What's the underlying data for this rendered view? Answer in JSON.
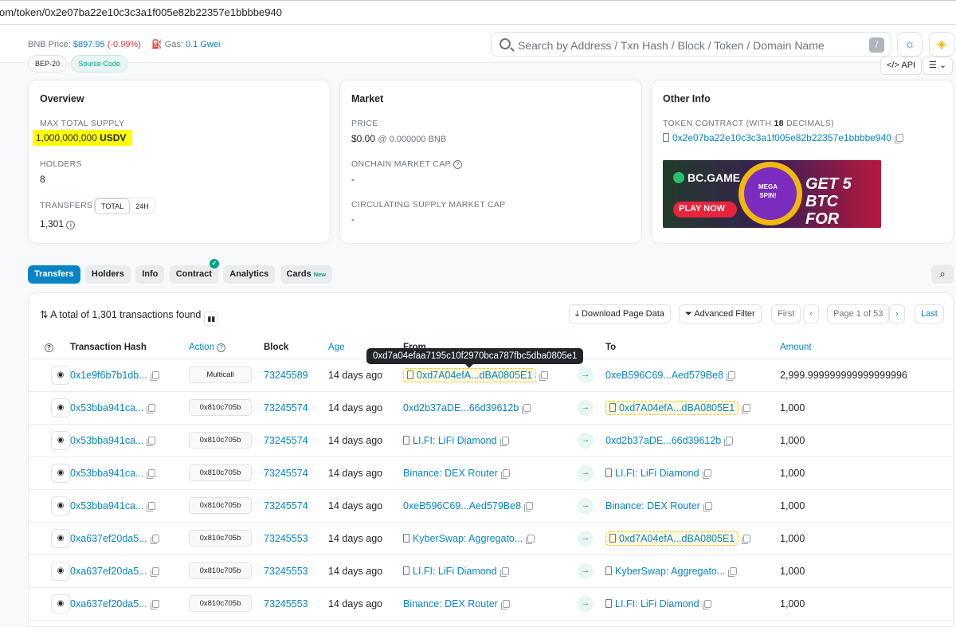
{
  "browser": {
    "url": "om/token/0x2e07ba22e10c3c3a1f005e82b22357e1bbbbe940"
  },
  "header": {
    "bnb_label": "BNB Price:",
    "bnb_price": "$897.95",
    "bnb_change": "(-0.99%)",
    "gas_label": "Gas:",
    "gas_value": "0.1 Gwei",
    "search_placeholder": "Search by Address / Txn Hash / Block / Token / Domain Name",
    "search_shortcut": "/"
  },
  "tags": [
    "BEP-20",
    "Source Code"
  ],
  "api_label": "API",
  "overview": {
    "title": "Overview",
    "max_supply_label": "MAX TOTAL SUPPLY",
    "max_supply_value": "1,000,000,000",
    "max_supply_unit": "USDV",
    "holders_label": "HOLDERS",
    "holders_value": "8",
    "transfers_label": "TRANSFERS",
    "toggle_total": "TOTAL",
    "toggle_24h": "24H",
    "transfers_value": "1,301"
  },
  "market": {
    "title": "Market",
    "price_label": "PRICE",
    "price_value": "$0.00",
    "price_bnb": "@ 0.000000 BNB",
    "onchain_label": "ONCHAIN MARKET CAP",
    "onchain_value": "-",
    "circ_label": "CIRCULATING SUPPLY MARKET CAP",
    "circ_value": "-"
  },
  "other": {
    "title": "Other Info",
    "contract_label_a": "TOKEN CONTRACT (WITH ",
    "decimals": "18",
    "contract_label_b": " DECIMALS)",
    "contract_address": "0x2e07ba22e10c3c3a1f005e82b22357e1bbbbe940",
    "ad": {
      "brand": "BC.GAME",
      "cta": "PLAY NOW",
      "headline_1": "GET 5 BTC",
      "headline_2": "FOR FREE",
      "badge_1": "MEGA",
      "badge_2": "SPIN!"
    }
  },
  "tabs": {
    "transfers": "Transfers",
    "holders": "Holders",
    "info": "Info",
    "contract": "Contract",
    "analytics": "Analytics",
    "cards": "Cards",
    "cards_new": "New"
  },
  "table_header": {
    "total_text": "A total of 1,301 transactions found",
    "download": "Download Page Data",
    "filter": "Advanced Filter",
    "first": "First",
    "page": "Page 1 of 53",
    "last": "Last",
    "tooltip": "0xd7a04efaa7195c10f2970bca787fbc5dba0805e1"
  },
  "columns": {
    "hash": "Transaction Hash",
    "action": "Action",
    "block": "Block",
    "age": "Age",
    "from": "From",
    "to": "To",
    "amount": "Amount"
  },
  "rows": [
    {
      "hash": "0x1e9f6b7b1db...",
      "method": "Multicall",
      "block": "73245589",
      "age": "14 days ago",
      "from": "0xd7A04efA...dBA0805E1",
      "from_doc": true,
      "from_hl": true,
      "to": "0xeB596C69...Aed579Be8",
      "to_doc": false,
      "to_hl": false,
      "amount": "2,999.999999999999999996"
    },
    {
      "hash": "0x53bba941ca...",
      "method": "0x810c705b",
      "block": "73245574",
      "age": "14 days ago",
      "from": "0xd2b37aDE...66d39612b",
      "from_doc": false,
      "from_hl": false,
      "to": "0xd7A04efA...dBA0805E1",
      "to_doc": true,
      "to_hl": true,
      "amount": "1,000"
    },
    {
      "hash": "0x53bba941ca...",
      "method": "0x810c705b",
      "block": "73245574",
      "age": "14 days ago",
      "from": "LI.FI: LiFi Diamond",
      "from_doc": true,
      "from_hl": false,
      "to": "0xd2b37aDE...66d39612b",
      "to_doc": false,
      "to_hl": false,
      "amount": "1,000"
    },
    {
      "hash": "0x53bba941ca...",
      "method": "0x810c705b",
      "block": "73245574",
      "age": "14 days ago",
      "from": "Binance: DEX Router",
      "from_doc": false,
      "from_hl": false,
      "to": "LI.FI: LiFi Diamond",
      "to_doc": true,
      "to_hl": false,
      "amount": "1,000"
    },
    {
      "hash": "0x53bba941ca...",
      "method": "0x810c705b",
      "block": "73245574",
      "age": "14 days ago",
      "from": "0xeB596C69...Aed579Be8",
      "from_doc": false,
      "from_hl": false,
      "to": "Binance: DEX Router",
      "to_doc": false,
      "to_hl": false,
      "amount": "1,000"
    },
    {
      "hash": "0xa637ef20da5...",
      "method": "0x810c705b",
      "block": "73245553",
      "age": "14 days ago",
      "from": "KyberSwap: Aggregato...",
      "from_doc": true,
      "from_hl": false,
      "to": "0xd7A04efA...dBA0805E1",
      "to_doc": true,
      "to_hl": true,
      "amount": "1,000"
    },
    {
      "hash": "0xa637ef20da5...",
      "method": "0x810c705b",
      "block": "73245553",
      "age": "14 days ago",
      "from": "LI.FI: LiFi Diamond",
      "from_doc": true,
      "from_hl": false,
      "to": "KyberSwap: Aggregato...",
      "to_doc": true,
      "to_hl": false,
      "amount": "1,000"
    },
    {
      "hash": "0xa637ef20da5...",
      "method": "0x810c705b",
      "block": "73245553",
      "age": "14 days ago",
      "from": "Binance: DEX Router",
      "from_doc": false,
      "from_hl": false,
      "to": "LI.FI: LiFi Diamond",
      "to_doc": true,
      "to_hl": false,
      "amount": "1,000"
    }
  ],
  "colors": {
    "link": "#0784c3",
    "highlight": "#ffff00",
    "accent_green": "#00a186",
    "tooltip_bg": "#212529"
  }
}
